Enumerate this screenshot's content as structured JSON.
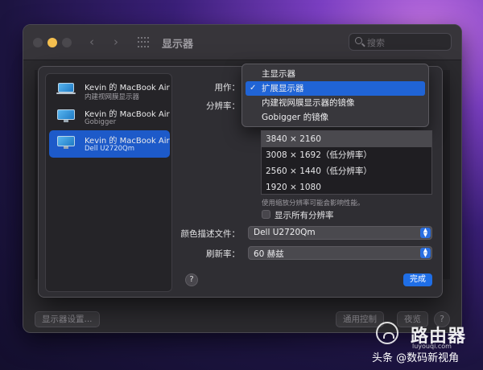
{
  "window": {
    "title": "显示器",
    "search_placeholder": "搜索"
  },
  "bottom_bar": {
    "display_settings": "显示器设置...",
    "universal_control": "通用控制",
    "night_shift": "夜览",
    "help": "?"
  },
  "displays": [
    {
      "name": "Kevin 的 MacBook Air",
      "sub": "内建视网膜显示器",
      "icon": "laptop-icon",
      "selected": false
    },
    {
      "name": "Kevin 的 MacBook Air",
      "sub": "Gobigger",
      "icon": "monitor-icon",
      "selected": false
    },
    {
      "name": "Kevin 的 MacBook Air",
      "sub": "Dell U2720Qm",
      "icon": "monitor-icon",
      "selected": true
    }
  ],
  "use_as": {
    "label": "用作：",
    "options": [
      {
        "label": "主显示器",
        "checked": false
      },
      {
        "label": "扩展显示器",
        "checked": true
      },
      {
        "label": "内建视网膜显示器的镜像",
        "checked": false
      },
      {
        "label": "Gobigger 的镜像",
        "checked": false
      }
    ],
    "check_glyph": "✓"
  },
  "resolution": {
    "label": "分辨率：",
    "options": [
      "3840 × 2160",
      "3008 × 1692（低分辨率）",
      "2560 × 1440（低分辨率）",
      "1920 × 1080"
    ],
    "selected_index": 0,
    "note": "使用缩放分辨率可能会影响性能。",
    "show_all_label": "显示所有分辨率",
    "show_all_checked": false
  },
  "color_profile": {
    "label": "颜色描述文件：",
    "value": "Dell U2720Qm"
  },
  "refresh_rate": {
    "label": "刷新率：",
    "value": "60 赫兹"
  },
  "buttons": {
    "help": "?",
    "done": "完成"
  },
  "watermark": {
    "title": "路由器",
    "url": "luyouqi.com",
    "bottom": "头条 @数码新视角"
  },
  "colors": {
    "accent": "#1d5ac9",
    "done_button": "#1f6ee6",
    "yellow_light": "#f4bf4f"
  }
}
